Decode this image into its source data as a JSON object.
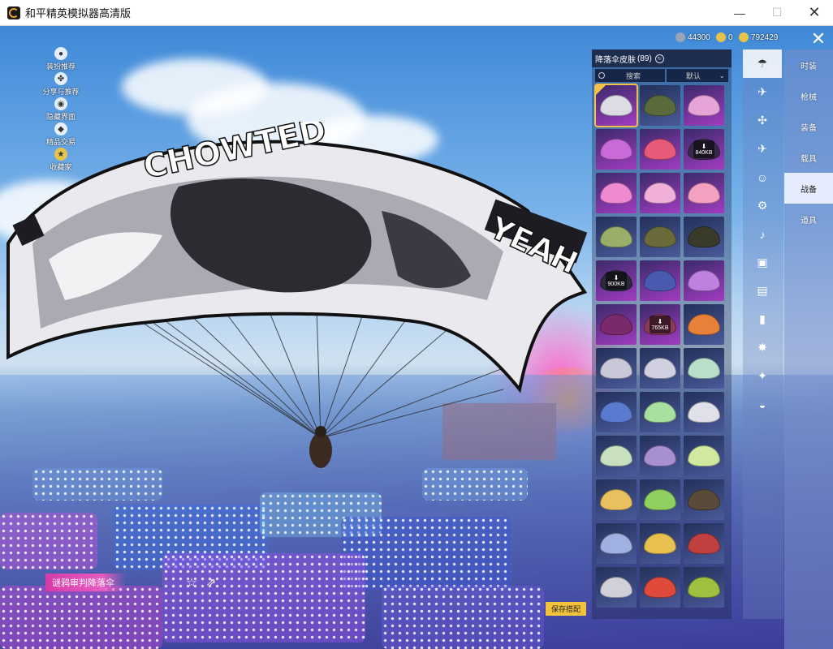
{
  "window": {
    "title": "和平精英模拟器高清版",
    "min": "—",
    "max": "☐",
    "close": "✕"
  },
  "left_menu": [
    {
      "label": "装扮推荐",
      "icon": "person-icon"
    },
    {
      "label": "分享与推荐",
      "icon": "share-hub-icon"
    },
    {
      "label": "隐藏界面",
      "icon": "eye-icon"
    },
    {
      "label": "精品交易",
      "icon": "shop-icon"
    },
    {
      "label": "收藏家",
      "icon": "badge-icon"
    }
  ],
  "currency": [
    {
      "icon": "gem-icon",
      "value": "44300",
      "color": "#9aa3b8"
    },
    {
      "icon": "coin-icon",
      "value": "0",
      "color": "#e8c34a"
    },
    {
      "icon": "gold-icon",
      "value": "792429",
      "color": "#e8c34a"
    }
  ],
  "panel": {
    "title": "降落伞皮肤",
    "count": "(89)",
    "search_placeholder": "搜索",
    "sort_label": "默认"
  },
  "download_badges": {
    "r2c3": "840KB",
    "r5c1": "900KB",
    "r6c2": "765KB"
  },
  "categories": [
    {
      "label": "时装",
      "active": false
    },
    {
      "label": "枪械",
      "active": false
    },
    {
      "label": "装备",
      "active": false
    },
    {
      "label": "载具",
      "active": false
    },
    {
      "label": "战备",
      "active": true
    },
    {
      "label": "道具",
      "active": false
    }
  ],
  "bottom": {
    "item_name": "谜鸦审判降落伞",
    "save_label": "保存搭配"
  },
  "colors": {
    "accent": "#f2c23a",
    "legendary": "#a23cc0",
    "name_tag": "#d63aa8"
  }
}
